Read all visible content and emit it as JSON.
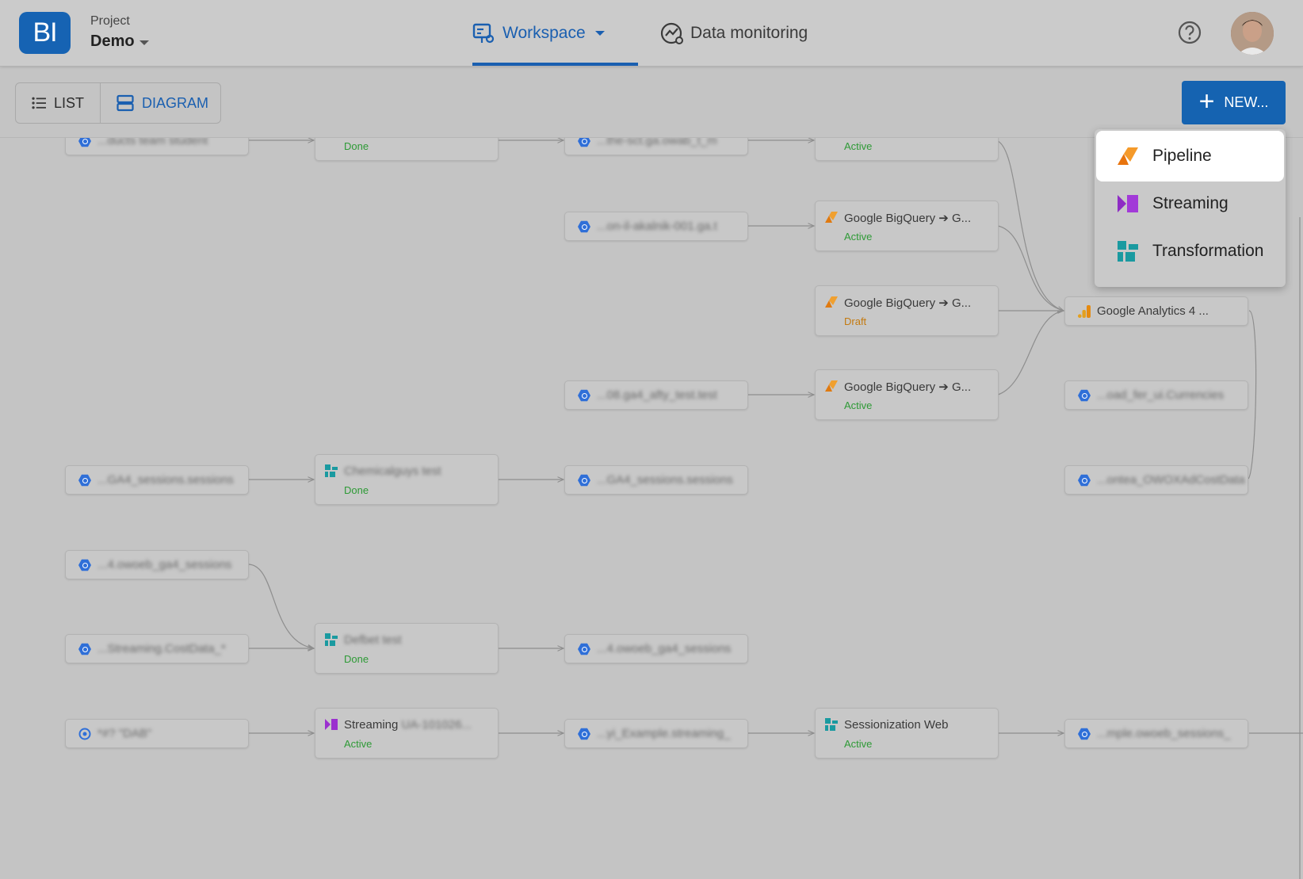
{
  "app": {
    "logo_text": "BI",
    "accent": "#1563b1"
  },
  "project": {
    "caption": "Project",
    "name": "Demo"
  },
  "nav": {
    "workspace": "Workspace",
    "data_monitoring": "Data monitoring"
  },
  "toolbar": {
    "list_label": "LIST",
    "diagram_label": "DIAGRAM",
    "new_label": "NEW..."
  },
  "new_menu": {
    "items": [
      {
        "label": "Pipeline",
        "icon": "pipeline-icon",
        "color": "#f08a1c"
      },
      {
        "label": "Streaming",
        "icon": "streaming-icon",
        "color": "#9b2fcf"
      },
      {
        "label": "Transformation",
        "icon": "transformation-icon",
        "color": "#1a9aa0"
      }
    ]
  },
  "diagram": {
    "nodes": [
      {
        "id": "r0c1",
        "status": "Done"
      },
      {
        "id": "r0c3",
        "status": "Active"
      },
      {
        "id": "r1c3",
        "title": "Google BigQuery ➔ G...",
        "status": "Active"
      },
      {
        "id": "r2c3",
        "title": "Google BigQuery ➔ G...",
        "status": "Draft"
      },
      {
        "id": "r3c3",
        "title": "Google BigQuery ➔ G...",
        "status": "Active"
      },
      {
        "id": "r2c4",
        "title": "Google Analytics 4 ..."
      },
      {
        "id": "r4c1",
        "status": "Done"
      },
      {
        "id": "r6c1",
        "status": "Done"
      },
      {
        "id": "r7c1",
        "title": "Streaming",
        "status": "Active"
      },
      {
        "id": "r7c3",
        "title": "Sessionization Web",
        "status": "Active"
      }
    ]
  }
}
